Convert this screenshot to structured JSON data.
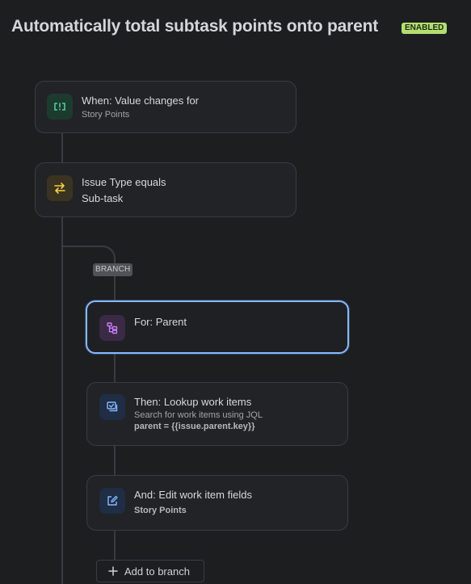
{
  "header": {
    "title": "Automatically total subtask points onto parent",
    "status_badge": "ENABLED"
  },
  "flow": {
    "trigger": {
      "title": "When: Value changes for",
      "subtitle": "Story Points",
      "icon": "field-value-icon"
    },
    "condition": {
      "title": "Issue Type equals",
      "subtitle": "Sub-task",
      "icon": "swap-arrows-icon"
    },
    "branch_label": "BRANCH",
    "branch_steps": [
      {
        "title": "For: Parent",
        "icon": "hierarchy-icon"
      },
      {
        "title": "Then: Lookup work items",
        "subtitle": "Search for work items using JQL",
        "detail": "parent = {{issue.parent.key}}",
        "icon": "lookup-icon"
      },
      {
        "title": "And: Edit work item fields",
        "subtitle": "Story Points",
        "icon": "edit-icon"
      }
    ],
    "add_to_branch_label": "Add to branch"
  },
  "colors": {
    "background": "#1d1e20",
    "badge": "#b3df72",
    "selected_border": "#85b8ff",
    "trigger_icon": "#4bce97",
    "condition_icon": "#f5cd47",
    "branch_icon": "#c97cf4",
    "action_icon": "#85b8ff"
  }
}
